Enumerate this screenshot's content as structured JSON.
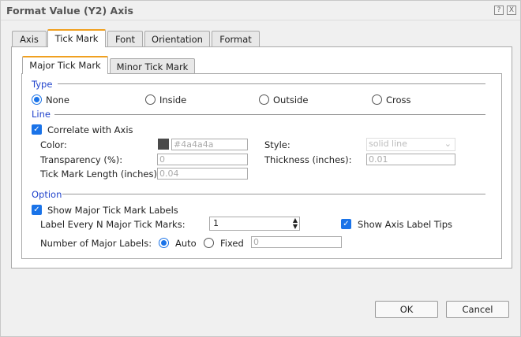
{
  "title": "Format Value (Y2) Axis",
  "tabs": [
    "Axis",
    "Tick Mark",
    "Font",
    "Orientation",
    "Format"
  ],
  "subtabs": [
    "Major Tick Mark",
    "Minor Tick Mark"
  ],
  "type": {
    "legend": "Type",
    "options": [
      "None",
      "Inside",
      "Outside",
      "Cross"
    ],
    "selected": "None"
  },
  "line": {
    "legend": "Line",
    "correlate": "Correlate with Axis",
    "correlate_checked": true,
    "color_label": "Color:",
    "color_value": "#4a4a4a",
    "swatch": "#4a4a4a",
    "style_label": "Style:",
    "style_value": "solid line",
    "transparency_label": "Transparency (%):",
    "transparency_value": "0",
    "thickness_label": "Thickness (inches):",
    "thickness_value": "0.01",
    "length_label": "Tick Mark Length (inches):",
    "length_value": "0.04"
  },
  "option": {
    "legend": "Option",
    "show_labels": "Show Major Tick Mark Labels",
    "show_labels_checked": true,
    "every_label": "Label Every N Major Tick Marks:",
    "every_value": "1",
    "tips": "Show Axis Label Tips",
    "tips_checked": true,
    "number_label": "Number of Major Labels:",
    "auto": "Auto",
    "fixed": "Fixed",
    "number_selected": "Auto",
    "fixed_value": "0"
  },
  "buttons": {
    "ok": "OK",
    "cancel": "Cancel",
    "help": "?",
    "close": "X"
  }
}
